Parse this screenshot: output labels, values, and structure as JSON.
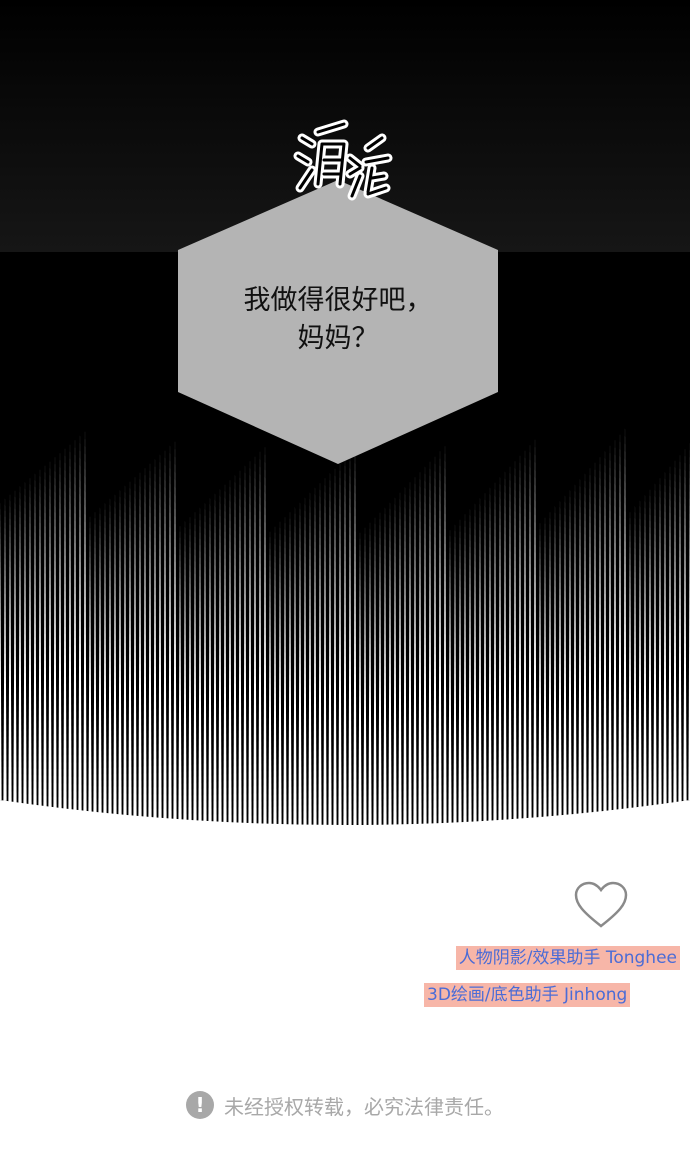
{
  "panel": {
    "sfx_text": "涌塔",
    "speech_lines": [
      "我做得很好吧，",
      "妈妈？"
    ]
  },
  "like": {
    "icon": "heart-outline-icon"
  },
  "credits": [
    {
      "role": "人物阴影/效果助手",
      "name": "Tonghee"
    },
    {
      "role": "3D绘画/底色助手",
      "name": "Jinhong"
    }
  ],
  "notice": {
    "icon": "exclamation-circle-icon",
    "text": "未经授权转载，必究法律责任。"
  },
  "colors": {
    "panel_black": "#000000",
    "bubble_gray": "#b4b4b4",
    "credit_highlight": "#f7b6a8",
    "credit_text": "#4b6cd6",
    "notice_gray": "#a8a8a8"
  }
}
